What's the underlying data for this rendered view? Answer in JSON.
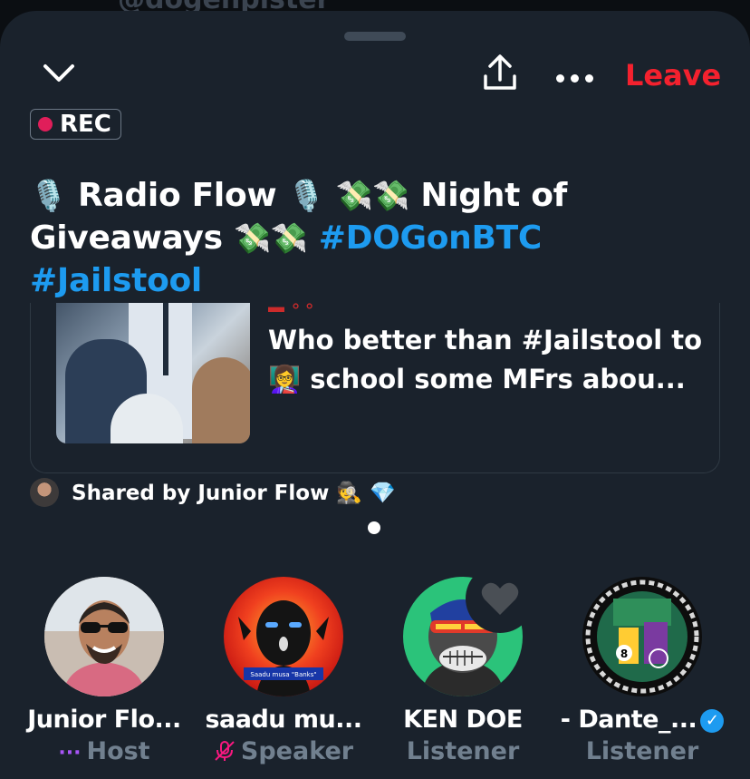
{
  "peek_text": "@dogenpister",
  "header": {
    "leave_label": "Leave"
  },
  "rec_label": "REC",
  "title": {
    "part1": "Radio Flow",
    "part2": "Night of Giveaways",
    "hashtag1": "#DOGonBTC",
    "hashtag2": "#Jailstool"
  },
  "card": {
    "line1": "Who better than #Jailstool to",
    "line2": "school some MFrs abou..."
  },
  "shared": {
    "text": "Shared by Junior Flow"
  },
  "participants": [
    {
      "name": "Junior Flo...",
      "role": "Host"
    },
    {
      "name": "saadu mu...",
      "role": "Speaker",
      "avatar_caption": "Saadu musa \"Banks\""
    },
    {
      "name": "KEN DOE",
      "role": "Listener"
    },
    {
      "name": "- Dante_...",
      "role": "Listener"
    }
  ],
  "colors": {
    "accent": "#1d9bf0",
    "leave": "#f4212e",
    "rec_dot": "#e01e5a",
    "sheet_bg": "#1a222c",
    "role_text": "#71808f"
  },
  "icons": [
    "chevron-down-icon",
    "share-icon",
    "more-icon",
    "heart-icon",
    "verified-icon",
    "mic-off-icon"
  ]
}
